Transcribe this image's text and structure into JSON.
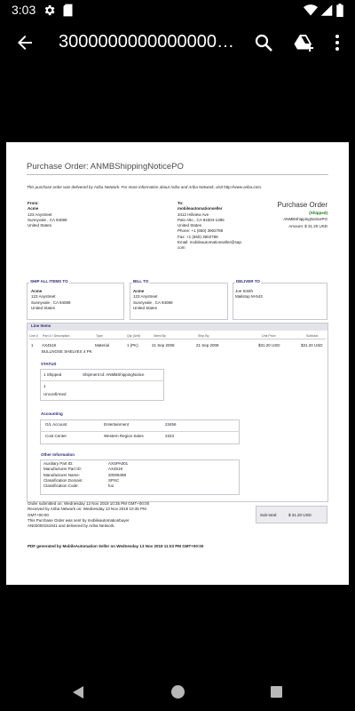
{
  "status_bar": {
    "time": "3:03"
  },
  "app_bar": {
    "title": "3000000000000000000000000"
  },
  "document": {
    "title": "Purchase Order: ANMBShippingNoticePO",
    "intro": "This purchase order was delivered by Ariba Network.  For more information about Ariba and Ariba Network, visit http://www.ariba.com.",
    "from": {
      "label": "From:",
      "name": "Acme",
      "line1": "123 Anystreet",
      "line2": "Sunnyvale , CA 94089",
      "line3": "United States"
    },
    "to": {
      "label": "To:",
      "name": "mobileautomationseller",
      "line1": "3412 Hillview Ave",
      "line2": "Palo Alto , CA 94304-1395",
      "line3": "United States",
      "phone": "Phone: +1 (650) 3902788",
      "fax": "Fax: +1 (650) 3902788",
      "email1": "Email: mobileautomationseller@sap.",
      "email2": "com"
    },
    "po_box": {
      "heading": "Purchase Order",
      "status": "(Shipped)",
      "number": "ANMBShippingNoticePO",
      "amount": "Amount: $  31.20  USD"
    },
    "ship_to": {
      "header": "SHIP ALL ITEMS TO",
      "name": "Acme",
      "line1": "123 Anystreet",
      "line2": "Sunnyvale , CA 94089",
      "line3": "United States"
    },
    "bill_to": {
      "header": "BILL TO",
      "name": "Acme",
      "line1": "123 Anystreet",
      "line2": "Sunnyvale , CA 94089",
      "line3": "United States"
    },
    "deliver_to": {
      "header": "DELIVER TO",
      "line1": "Joe Smith",
      "line2": "Mailstop M-543"
    },
    "line_items": {
      "label": "Line Items",
      "headers": [
        "Line #",
        "Part # / Description",
        "Type",
        "Qty (Unit)",
        "Need By",
        "Ship By",
        "Unit Price",
        "Subtotal"
      ],
      "row": [
        "1",
        "AX4518",
        "Material",
        "1 (PK)",
        "21 Sep 2008",
        "21 Sep 2008",
        "$31.20 USD",
        "$31.20 USD"
      ],
      "description": "BULLNOSE SHELVES 4 PK"
    },
    "status_section": {
      "title": "STATUS",
      "shipped_qty": "1 Shipped",
      "shipment_id": "Shipment Id: ANMBShippingNotice",
      "unconfirmed_qty": "1",
      "unconfirmed_label": "Unconfirmed"
    },
    "accounting": {
      "title": "Accounting",
      "rows": [
        [
          "G/L Account",
          "Entertainment",
          "23456"
        ],
        [
          "Cost Center",
          "Western Region Sales",
          "2323"
        ]
      ]
    },
    "other_info": {
      "title": "Other Information",
      "rows": [
        [
          "Auxiliary Part ID:",
          "AXSPA001"
        ],
        [
          "Manufacturer Part ID:",
          "AX4518"
        ],
        [
          "Manufacturer Name:",
          "20008498"
        ],
        [
          "Classification Domain:",
          "SPSC"
        ],
        [
          "Classification Code:",
          "foo"
        ]
      ]
    },
    "footer": {
      "line1": "Order submitted on: Wednesday 13 Nov 2019 10:35 PM GMT+00:00",
      "line2": "Received by Ariba Network on: Wednesday 13 Nov 2019 10:35 PM",
      "line3": "GMT+00:00",
      "line4": "This Purchase Order was sent by mobileautomationbuyer",
      "line5": "AN02000151941 and delivered by Ariba Network.",
      "subtotal_label": "Sub-total:",
      "subtotal_value": "$   31.20   USD",
      "generated": "PDF generated by MobileAutomation Seller on Wednesday 13 Nov 2019 11:03 PM GMT+00:00"
    }
  },
  "colors": {
    "header_blue": "#2a2a7a",
    "shipped_green": "#1a7a1a",
    "bar_background": "#000000"
  },
  "icons": [
    "settings-icon",
    "sd-card-icon",
    "wifi-icon",
    "signal-icon",
    "battery-icon",
    "back-arrow-icon",
    "search-icon",
    "add-to-drive-icon",
    "more-vert-icon"
  ]
}
